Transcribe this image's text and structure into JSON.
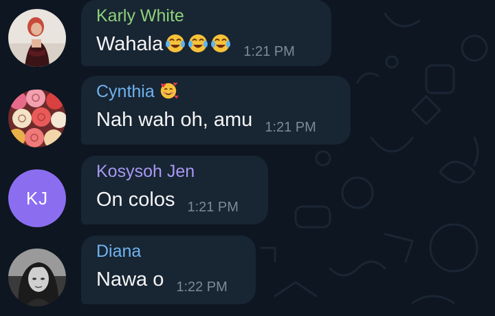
{
  "messages": [
    {
      "sender": "Karly White",
      "sender_color": "#8fd17a",
      "text": "Wahala",
      "trailing_emoji": [
        "face-with-tears-of-joy-icon",
        "face-with-tears-of-joy-icon",
        "face-with-tears-of-joy-icon"
      ],
      "time": "1:21 PM",
      "avatar": "photo"
    },
    {
      "sender": "Cynthia",
      "sender_emoji": "smiling-face-with-hearts-icon",
      "sender_color": "#6fb3f0",
      "text": "Nah wah oh, amu",
      "time": "1:21 PM",
      "avatar": "photo"
    },
    {
      "sender": "Kosysoh Jen",
      "sender_color": "#a799f2",
      "text": "On colos",
      "time": "1:21 PM",
      "avatar": "initials",
      "initials": "KJ",
      "avatar_color": "#8b6ef0"
    },
    {
      "sender": "Diana",
      "sender_color": "#6fb3f0",
      "text": "Nawa o",
      "time": "1:22 PM",
      "avatar": "photo"
    }
  ]
}
